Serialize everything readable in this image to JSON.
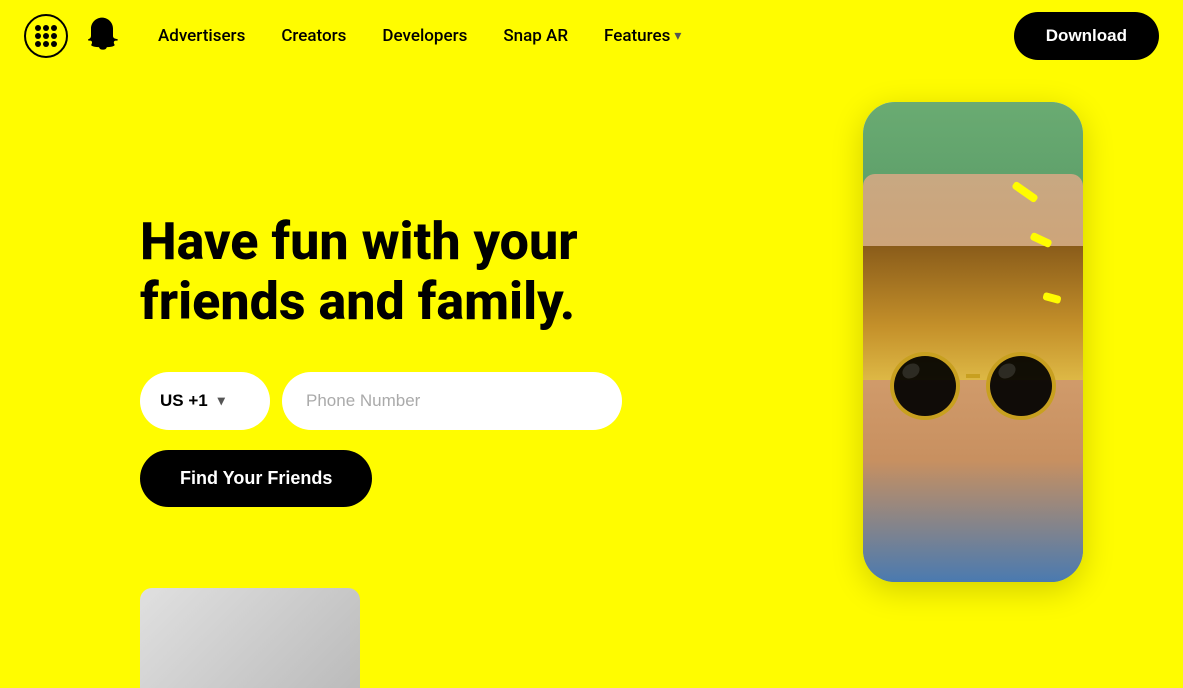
{
  "navbar": {
    "grid_icon_label": "grid-icon",
    "logo_label": "snapchat-logo",
    "links": [
      {
        "id": "advertisers",
        "label": "Advertisers"
      },
      {
        "id": "creators",
        "label": "Creators"
      },
      {
        "id": "developers",
        "label": "Developers"
      },
      {
        "id": "snap-ar",
        "label": "Snap AR"
      },
      {
        "id": "features",
        "label": "Features",
        "has_dropdown": true
      }
    ],
    "download_label": "Download"
  },
  "hero": {
    "title": "Have fun with your friends and family.",
    "form": {
      "country_code": "US +1",
      "phone_placeholder": "Phone Number",
      "cta_label": "Find Your Friends"
    }
  },
  "icons": {
    "chevron_down": "▾"
  }
}
